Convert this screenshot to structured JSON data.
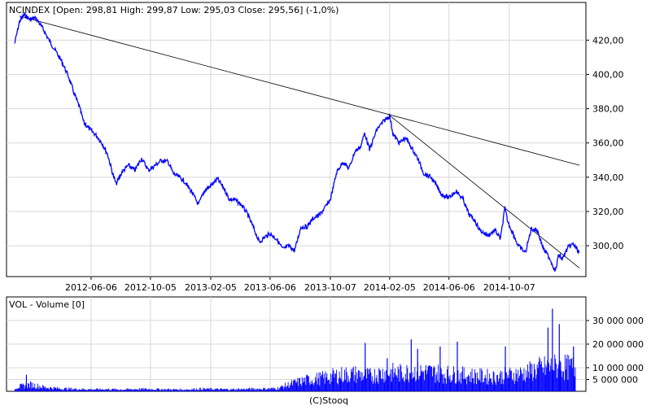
{
  "chart_data": [
    {
      "type": "line",
      "title": "NCINDEX [Open: 298,81  High: 299,87  Low: 295,03  Close: 295,56] (-1,0%)",
      "xlabel": "",
      "ylabel": "",
      "xlim": [
        "2012-01-02",
        "2015-02-27"
      ],
      "ylim": [
        282,
        442
      ],
      "grid": true,
      "y_ticks": [
        "300,00",
        "320,00",
        "340,00",
        "360,00",
        "380,00",
        "400,00",
        "420,00"
      ],
      "y_tick_values": [
        300,
        320,
        340,
        360,
        380,
        400,
        420
      ],
      "x_ticks": [
        "2012-06-06",
        "2012-10-05",
        "2013-02-05",
        "2013-06-06",
        "2013-10-07",
        "2014-02-05",
        "2014-06-06",
        "2014-10-07"
      ],
      "series": [
        {
          "color": "#0000ff",
          "points": [
            [
              "2012-01-02",
              418
            ],
            [
              "2012-01-12",
              431
            ],
            [
              "2012-01-22",
              435
            ],
            [
              "2012-02-02",
              432
            ],
            [
              "2012-02-14",
              433
            ],
            [
              "2012-02-28",
              427
            ],
            [
              "2012-03-12",
              420
            ],
            [
              "2012-03-27",
              413
            ],
            [
              "2012-04-08",
              407
            ],
            [
              "2012-04-22",
              398
            ],
            [
              "2012-05-01",
              390
            ],
            [
              "2012-05-13",
              381
            ],
            [
              "2012-05-22",
              372
            ],
            [
              "2012-06-03",
              368
            ],
            [
              "2012-06-18",
              364
            ],
            [
              "2012-06-30",
              359
            ],
            [
              "2012-07-10",
              353
            ],
            [
              "2012-07-20",
              342
            ],
            [
              "2012-07-27",
              336
            ],
            [
              "2012-08-08",
              343
            ],
            [
              "2012-08-21",
              347
            ],
            [
              "2012-09-03",
              344
            ],
            [
              "2012-09-17",
              351
            ],
            [
              "2012-10-01",
              344
            ],
            [
              "2012-10-15",
              347
            ],
            [
              "2012-10-28",
              350
            ],
            [
              "2012-11-10",
              349
            ],
            [
              "2012-11-21",
              342
            ],
            [
              "2012-12-03",
              340
            ],
            [
              "2012-12-15",
              337
            ],
            [
              "2012-12-29",
              331
            ],
            [
              "2013-01-11",
              324
            ],
            [
              "2013-01-23",
              332
            ],
            [
              "2013-02-05",
              335
            ],
            [
              "2013-02-19",
              339
            ],
            [
              "2013-03-05",
              333
            ],
            [
              "2013-03-15",
              327
            ],
            [
              "2013-03-25",
              327
            ],
            [
              "2013-04-08",
              324
            ],
            [
              "2013-04-20",
              319
            ],
            [
              "2013-05-04",
              310
            ],
            [
              "2013-05-15",
              302
            ],
            [
              "2013-05-26",
              305
            ],
            [
              "2013-06-06",
              307
            ],
            [
              "2013-06-19",
              304
            ],
            [
              "2013-07-02",
              298
            ],
            [
              "2013-07-15",
              300
            ],
            [
              "2013-07-26",
              297
            ],
            [
              "2013-08-08",
              311
            ],
            [
              "2013-08-20",
              311
            ],
            [
              "2013-09-02",
              316
            ],
            [
              "2013-09-15",
              318
            ],
            [
              "2013-09-28",
              323
            ],
            [
              "2013-10-07",
              327
            ],
            [
              "2013-10-20",
              343
            ],
            [
              "2013-11-02",
              349
            ],
            [
              "2013-11-14",
              345
            ],
            [
              "2013-11-26",
              355
            ],
            [
              "2013-12-08",
              358
            ],
            [
              "2013-12-16",
              366
            ],
            [
              "2013-12-26",
              356
            ],
            [
              "2014-01-10",
              368
            ],
            [
              "2014-01-25",
              373
            ],
            [
              "2014-02-05",
              376
            ],
            [
              "2014-02-12",
              365
            ],
            [
              "2014-02-25",
              360
            ],
            [
              "2014-03-10",
              363
            ],
            [
              "2014-03-22",
              357
            ],
            [
              "2014-04-03",
              351
            ],
            [
              "2014-04-16",
              342
            ],
            [
              "2014-04-30",
              340
            ],
            [
              "2014-05-12",
              335
            ],
            [
              "2014-05-22",
              330
            ],
            [
              "2014-06-06",
              328
            ],
            [
              "2014-06-20",
              332
            ],
            [
              "2014-07-05",
              327
            ],
            [
              "2014-07-17",
              318
            ],
            [
              "2014-07-28",
              315
            ],
            [
              "2014-08-08",
              309
            ],
            [
              "2014-08-24",
              306
            ],
            [
              "2014-09-08",
              309
            ],
            [
              "2014-09-19",
              304
            ],
            [
              "2014-09-28",
              322
            ],
            [
              "2014-10-04",
              314
            ],
            [
              "2014-10-15",
              307
            ],
            [
              "2014-10-25",
              300
            ],
            [
              "2014-11-09",
              296
            ],
            [
              "2014-11-21",
              310
            ],
            [
              "2014-12-03",
              309
            ],
            [
              "2014-12-16",
              298
            ],
            [
              "2014-12-28",
              293
            ],
            [
              "2015-01-09",
              285
            ],
            [
              "2015-01-16",
              295
            ],
            [
              "2015-01-23",
              292
            ],
            [
              "2015-02-04",
              299
            ],
            [
              "2015-02-14",
              301
            ],
            [
              "2015-02-27",
              296
            ]
          ]
        }
      ],
      "trendlines": [
        [
          [
            "2012-01-12",
            434
          ],
          [
            "2015-02-27",
            347
          ]
        ],
        [
          [
            "2014-02-01",
            377
          ],
          [
            "2015-02-27",
            287
          ]
        ]
      ]
    },
    {
      "type": "bar",
      "title": "VOL - Volume [0]",
      "xlabel": "",
      "ylabel": "",
      "xlim": [
        "2012-01-02",
        "2015-02-27"
      ],
      "ylim": [
        0,
        40000000
      ],
      "grid": true,
      "y_ticks": [
        "5 000 000",
        "10 000 000",
        "20 000 000",
        "30 000 000"
      ],
      "y_tick_values": [
        5000000,
        10000000,
        20000000,
        30000000
      ],
      "color": "#0000ff",
      "points": [
        [
          "2012-01-02",
          2000000
        ],
        [
          "2012-02-02",
          3500000
        ],
        [
          "2012-03-05",
          2000000
        ],
        [
          "2012-04-05",
          1400000
        ],
        [
          "2012-05-07",
          1200000
        ],
        [
          "2012-06-07",
          1000000
        ],
        [
          "2012-07-09",
          1100000
        ],
        [
          "2012-08-09",
          900000
        ],
        [
          "2012-09-10",
          1200000
        ],
        [
          "2012-10-11",
          1100000
        ],
        [
          "2012-11-12",
          1000000
        ],
        [
          "2012-12-13",
          900000
        ],
        [
          "2013-01-14",
          1300000
        ],
        [
          "2013-02-14",
          1100000
        ],
        [
          "2013-03-18",
          1000000
        ],
        [
          "2013-04-18",
          1200000
        ],
        [
          "2013-05-20",
          1300000
        ],
        [
          "2013-06-20",
          1500000
        ],
        [
          "2013-07-22",
          4200000
        ],
        [
          "2013-08-22",
          6000000
        ],
        [
          "2013-09-23",
          7000000
        ],
        [
          "2013-10-24",
          8500000
        ],
        [
          "2013-11-25",
          9000000
        ],
        [
          "2013-12-26",
          8000000
        ],
        [
          "2014-01-27",
          10000000
        ],
        [
          "2014-02-27",
          9500000
        ],
        [
          "2014-03-31",
          10500000
        ],
        [
          "2014-05-01",
          10000000
        ],
        [
          "2014-06-02",
          9000000
        ],
        [
          "2014-07-03",
          8500000
        ],
        [
          "2014-08-04",
          8000000
        ],
        [
          "2014-09-04",
          7500000
        ],
        [
          "2014-10-06",
          8500000
        ],
        [
          "2014-11-06",
          9500000
        ],
        [
          "2014-12-08",
          12000000
        ],
        [
          "2015-01-08",
          13000000
        ],
        [
          "2015-02-09",
          12500000
        ]
      ],
      "spikes": [
        [
          "2012-01-25",
          7000000
        ],
        [
          "2013-12-16",
          20500000
        ],
        [
          "2014-01-30",
          14000000
        ],
        [
          "2014-03-20",
          22000000
        ],
        [
          "2014-04-02",
          18000000
        ],
        [
          "2014-05-18",
          19000000
        ],
        [
          "2014-06-22",
          21000000
        ],
        [
          "2014-09-28",
          19000000
        ],
        [
          "2014-12-24",
          27000000
        ],
        [
          "2015-01-02",
          35000000
        ],
        [
          "2015-01-16",
          28500000
        ],
        [
          "2015-02-14",
          19000000
        ]
      ]
    }
  ],
  "footer": "(C)Stooq"
}
